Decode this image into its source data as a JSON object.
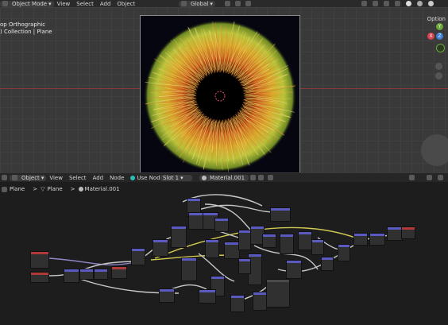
{
  "header": {
    "mode": "Object Mode",
    "menus": [
      "View",
      "Select",
      "Add",
      "Object"
    ],
    "orientation": "Global",
    "options_label": "Option"
  },
  "viewport": {
    "overlay_line1": "op Orthographic",
    "overlay_line2": ") Collection | Plane",
    "axes": {
      "y": "Y",
      "x": "X",
      "z": "Z"
    }
  },
  "node_header": {
    "editor_type": "Object",
    "menus": [
      "View",
      "Select",
      "Add",
      "Node"
    ],
    "use_nodes_label": "Use Nodes",
    "slot": "Slot 1",
    "material": "Material.001"
  },
  "breadcrumb": {
    "items": [
      "Plane",
      "Plane",
      "Material.001"
    ],
    "separator": ">"
  },
  "colors": {
    "accent": "#2dbfb5",
    "axis_x": "#d8434d",
    "axis_y": "#6aa83b",
    "axis_z": "#3b7fd8"
  }
}
